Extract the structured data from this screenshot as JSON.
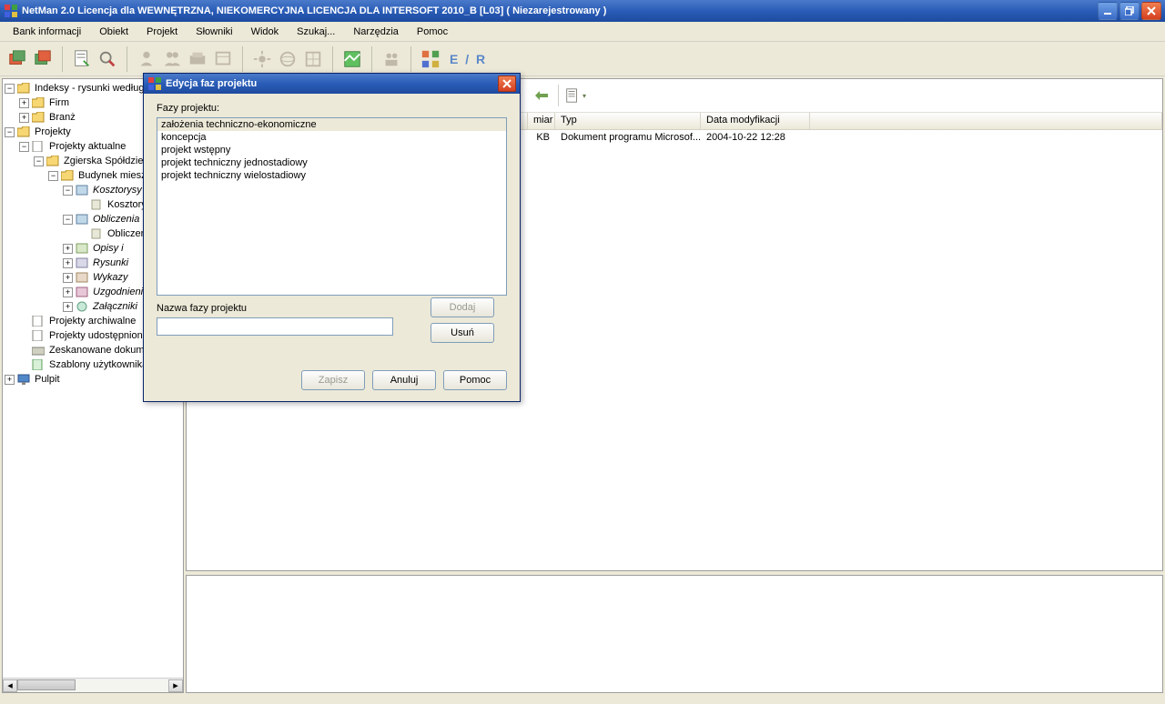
{
  "window": {
    "title": "NetMan 2.0 Licencja dla WEWNĘTRZNA, NIEKOMERCYJNA LICENCJA DLA INTERSOFT 2010_B [L03] ( Niezarejestrowany )"
  },
  "menu": [
    "Bank informacji",
    "Obiekt",
    "Projekt",
    "Słowniki",
    "Widok",
    "Szukaj...",
    "Narzędzia",
    "Pomoc"
  ],
  "toolbar": {
    "er": "E / R"
  },
  "tree": {
    "n0": "Indeksy - rysunki według",
    "n0a": "Firm",
    "n0b": "Branż",
    "n1": "Projekty",
    "n1a": "Projekty aktualne",
    "n1a1": "Zgierska Spółdzielnia",
    "n1a1a": "Budynek mieszk.",
    "n1a1a1": "Kosztorysy",
    "n1a1a1a": "Kosztorysy",
    "n1a1a2": "Obliczenia",
    "n1a1a2a": "Obliczenia",
    "n1a1a3": "Opisy i",
    "n1a1a4": "Rysunki",
    "n1a1a5": "Wykazy",
    "n1a1a6": "Uzgodnienia",
    "n1a1a7": "Załączniki",
    "n1b": "Projekty archiwalne",
    "n1c": "Projekty udostępnione",
    "n1d": "Zeskanowane dokumenty",
    "n1e": "Szablony użytkownika",
    "n2": "Pulpit"
  },
  "list": {
    "cols": {
      "size": "miar",
      "type": "Typ",
      "date": "Data modyfikacji"
    },
    "row": {
      "size": "KB",
      "type": "Dokument programu Microsof...",
      "date": "2004-10-22 12:28"
    }
  },
  "dialog": {
    "title": "Edycja faz projektu",
    "label_phases": "Fazy projektu:",
    "items": [
      "założenia techniczno-ekonomiczne",
      "koncepcja",
      "projekt wstępny",
      "projekt techniczny jednostadiowy",
      "projekt techniczny wielostadiowy"
    ],
    "label_name": "Nazwa fazy projektu",
    "btn_add": "Dodaj",
    "btn_del": "Usuń",
    "btn_save": "Zapisz",
    "btn_cancel": "Anuluj",
    "btn_help": "Pomoc"
  }
}
